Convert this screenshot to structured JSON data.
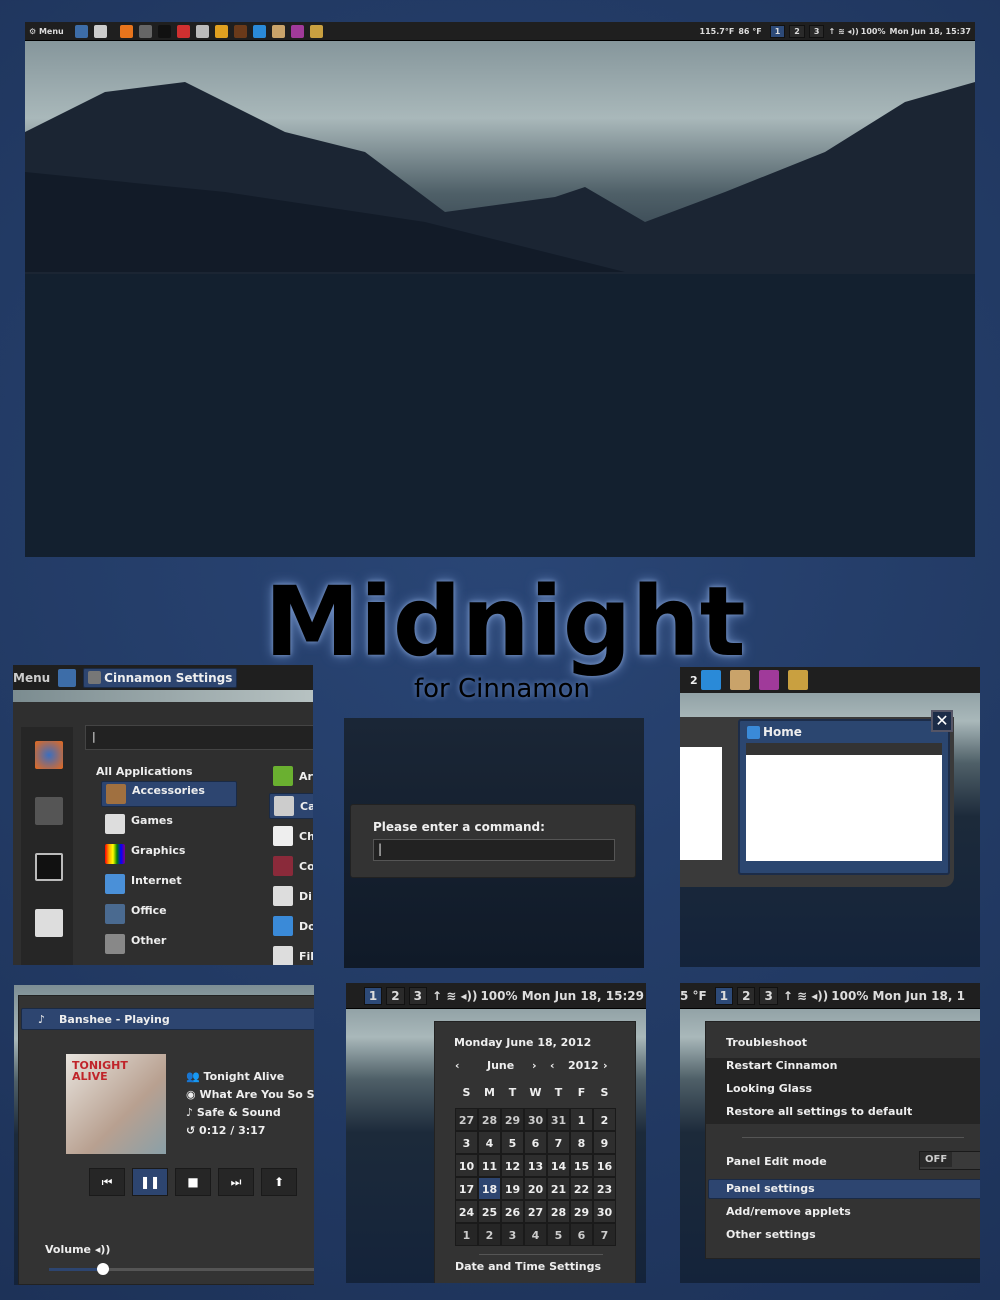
{
  "colors": {
    "accent": "#2d4570",
    "panel": "#1f1f1f",
    "background": "#223a63"
  },
  "top_panel": {
    "menu_label": "Menu",
    "weather": "115.7°F",
    "weather2": "86 °F",
    "workspaces": [
      "1",
      "2",
      "3"
    ],
    "battery": "100%",
    "clock": "Mon Jun 18, 15:37",
    "launchers": [
      "desktop-icon",
      "files-icon",
      "firefox-icon",
      "settings-icon",
      "terminal-icon",
      "office-icon",
      "calculator-icon",
      "banshee-icon",
      "presentation-icon",
      "shotwell-icon",
      "gimp-icon",
      "empathy-icon",
      "inkscape-icon"
    ]
  },
  "title": {
    "main": "Midnight",
    "sub": "for Cinnamon"
  },
  "menu_panel": {
    "menu_label": "Menu",
    "window_title": "Cinnamon Settings",
    "search_value": "",
    "all_apps": "All Applications",
    "categories": [
      "Accessories",
      "Games",
      "Graphics",
      "Internet",
      "Office",
      "Other"
    ],
    "apps": [
      "Ar",
      "Ca",
      "Ch",
      "Co",
      "Di",
      "Do",
      "Fil"
    ]
  },
  "run_dialog": {
    "prompt": "Please enter a command:",
    "value": ""
  },
  "expo": {
    "workspace_number": "2",
    "window_title": "Home"
  },
  "sound": {
    "header": "Banshee - Playing",
    "artist": "Tonight Alive",
    "album": "What Are You So S",
    "track": "Safe & Sound",
    "time": "0:12 / 3:17",
    "volume_label": "Volume",
    "volume": 0.2,
    "album_art_text": "TONIGHT ALIVE"
  },
  "calendar": {
    "panel_workspaces": [
      "1",
      "2",
      "3"
    ],
    "battery": "100%",
    "clock": "Mon Jun 18, 15:29",
    "date_heading": "Monday June 18, 2012",
    "month": "June",
    "year": "2012",
    "weekdays": [
      "S",
      "M",
      "T",
      "W",
      "T",
      "F",
      "S"
    ],
    "days": [
      "27",
      "28",
      "29",
      "30",
      "31",
      "1",
      "2",
      "3",
      "4",
      "5",
      "6",
      "7",
      "8",
      "9",
      "10",
      "11",
      "12",
      "13",
      "14",
      "15",
      "16",
      "17",
      "18",
      "19",
      "20",
      "21",
      "22",
      "23",
      "24",
      "25",
      "26",
      "27",
      "28",
      "29",
      "30",
      "1",
      "2",
      "3",
      "4",
      "5",
      "6",
      "7"
    ],
    "today": "18",
    "settings_link": "Date and Time Settings"
  },
  "panel_menu": {
    "temp": "5 °F",
    "workspaces": [
      "1",
      "2",
      "3"
    ],
    "battery": "100%",
    "clock": "Mon Jun 18, 1",
    "troubleshoot": "Troubleshoot",
    "troubleshoot_items": [
      "Restart Cinnamon",
      "Looking Glass",
      "Restore all settings to default"
    ],
    "edit_mode": "Panel Edit mode",
    "edit_state": "OFF",
    "items": [
      "Panel settings",
      "Add/remove applets",
      "Other settings"
    ]
  }
}
